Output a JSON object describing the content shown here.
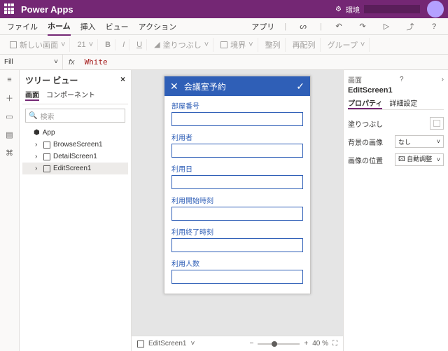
{
  "app": {
    "name": "Power Apps",
    "env_label": "環境"
  },
  "menu": {
    "file": "ファイル",
    "home": "ホーム",
    "insert": "挿入",
    "view": "ビュー",
    "action": "アクション",
    "apps": "アプリ"
  },
  "ribbon": {
    "new_screen": "新しい画面",
    "fontsize": "21",
    "fill": "塗りつぶし",
    "b": "B",
    "i": "I",
    "u": "U",
    "align": "整列",
    "reorder": "再配列",
    "group": "グループ"
  },
  "fx": {
    "property": "Fill",
    "fx_label": "fx",
    "value": "White"
  },
  "tree": {
    "title": "ツリー ビュー",
    "tab_screen": "画面",
    "tab_component": "コンポーネント",
    "search_placeholder": "検索",
    "app_node": "App",
    "screens": [
      "BrowseScreen1",
      "DetailScreen1",
      "EditScreen1"
    ],
    "selected_index": 2
  },
  "form": {
    "title": "会議室予約",
    "fields": [
      "部屋番号",
      "利用者",
      "利用日",
      "利用開始時刻",
      "利用終了時刻",
      "利用人数"
    ]
  },
  "status": {
    "screen": "EditScreen1",
    "zoom": "40 %"
  },
  "props": {
    "header": "画面",
    "question": "?",
    "name": "EditScreen1",
    "tab_prop": "プロパティ",
    "tab_adv": "詳細設定",
    "fill_label": "塗りつぶし",
    "bgimage_label": "背景の画像",
    "bgimage_value": "なし",
    "imgpos_label": "画像の位置",
    "imgpos_value": "自動調整"
  }
}
